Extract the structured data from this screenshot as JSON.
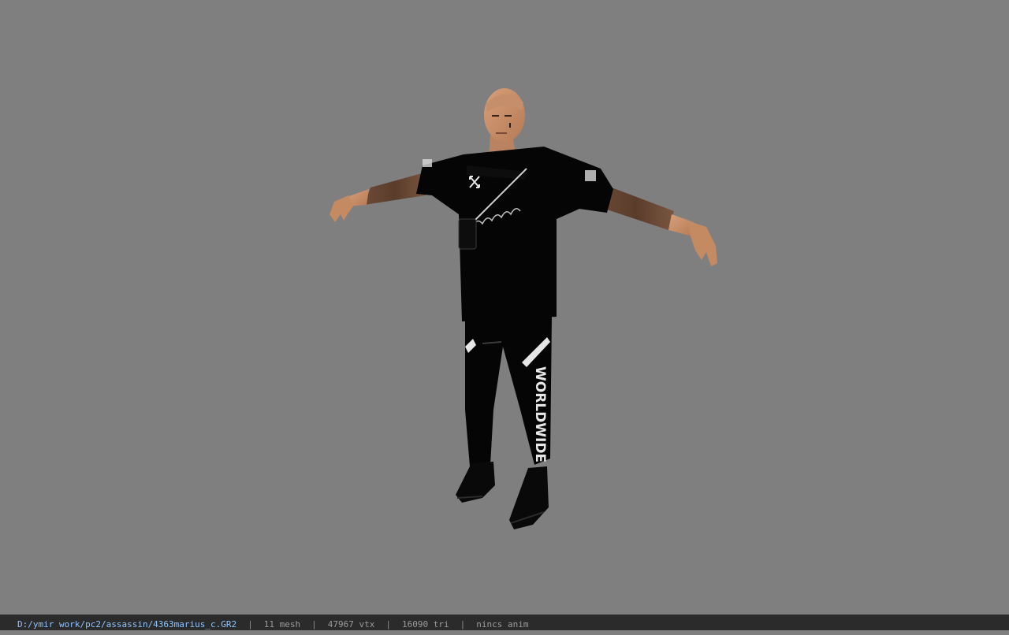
{
  "viewer": {
    "background_color": "#7f7f7f"
  },
  "model": {
    "shirt_logo_text": "WORLDWIDE"
  },
  "status_bar": {
    "file_path": "D:/ymir work/pc2/assassin/4363marius_c.GR2",
    "separator": "|",
    "mesh_count": "11 mesh",
    "vertex_count": "47967 vtx",
    "triangle_count": "16090 tri",
    "animation": "nincs anim"
  },
  "colors": {
    "status_bg": "#2b2b2b",
    "status_text": "#9a9a9a",
    "path_text": "#8fc4ff",
    "skin": "#c98f67",
    "clothing": "#050505"
  }
}
